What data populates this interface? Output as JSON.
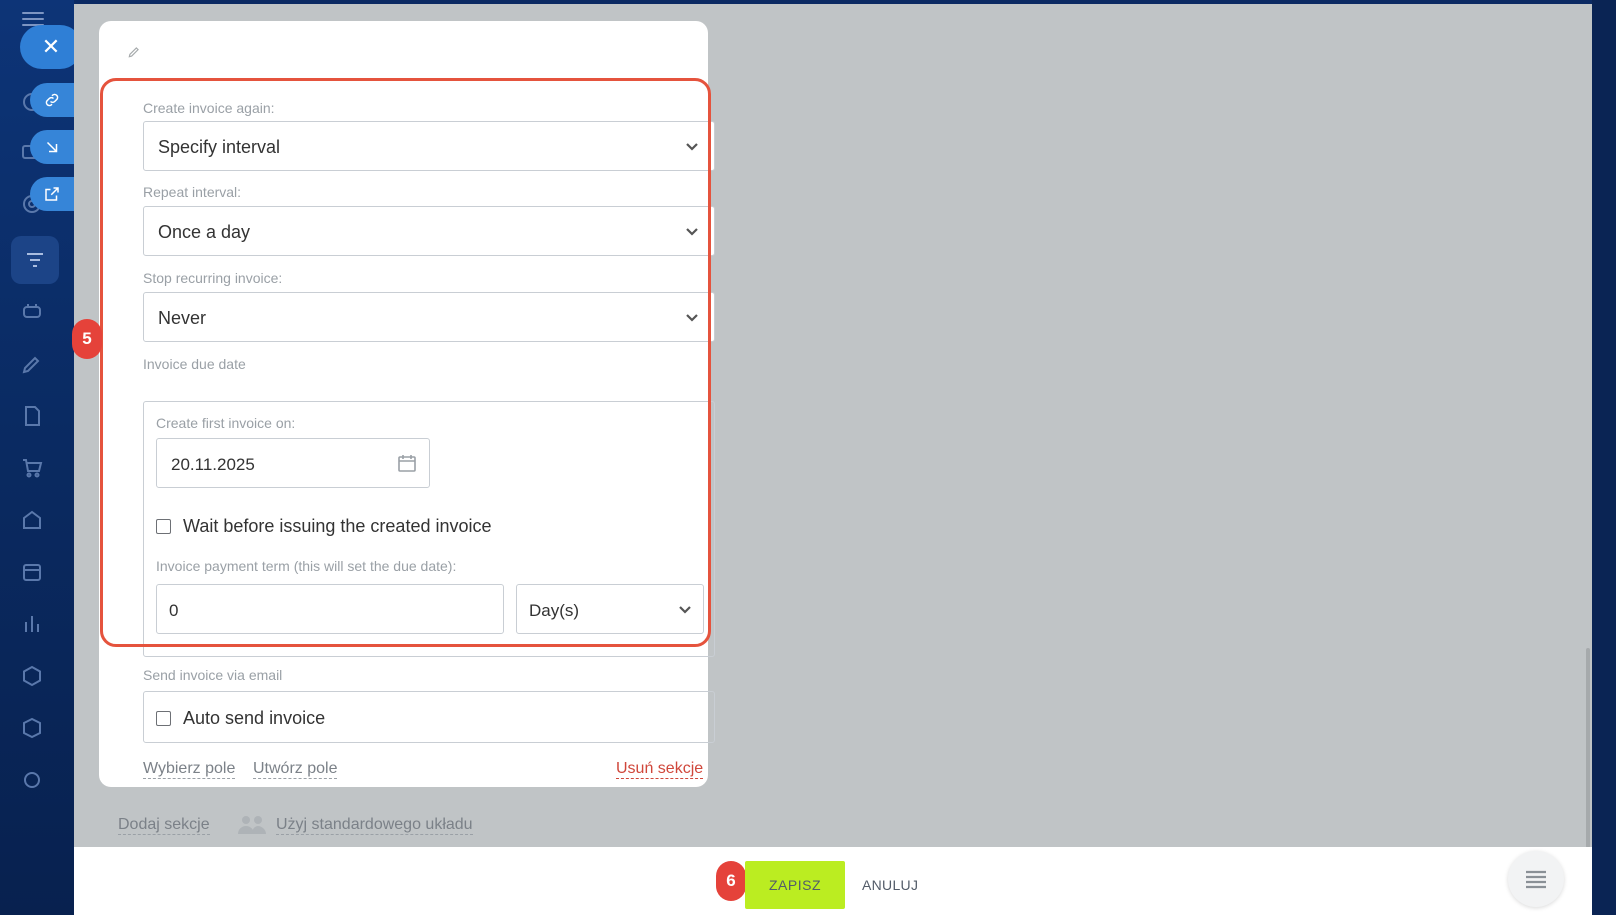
{
  "form": {
    "create_again_label": "Create invoice again:",
    "create_again_value": "Specify interval",
    "repeat_interval_label": "Repeat interval:",
    "repeat_interval_value": "Once a day",
    "stop_label": "Stop recurring invoice:",
    "stop_value": "Never",
    "due_date_label": "Invoice due date",
    "first_invoice_label": "Create first invoice on:",
    "first_invoice_date": "20.11.2025",
    "wait_label": "Wait before issuing the created invoice",
    "payment_term_label": "Invoice payment term (this will set the due date):",
    "payment_term_value": "0",
    "payment_term_unit": "Day(s)",
    "email_label": "Send invoice via email",
    "auto_send_label": "Auto send invoice",
    "choose_field": "Wybierz pole",
    "create_field": "Utwórz pole",
    "delete_section": "Usuń sekcje"
  },
  "below": {
    "add_section": "Dodaj sekcje",
    "use_standard_layout": "Użyj standardowego układu"
  },
  "badges": {
    "step5": "5",
    "step6": "6"
  },
  "footer": {
    "save_label": "ZAPISZ",
    "cancel_label": "ANULUJ"
  },
  "colors": {
    "highlight": "#e5533d",
    "save_button": "#bbed21",
    "badge": "#e5423a",
    "sidebar": "#0d3477"
  },
  "icons": {
    "close": "close-icon",
    "link": "link-icon",
    "download": "download-icon",
    "external": "external-link-icon",
    "calendar": "calendar-icon",
    "people": "people-icon",
    "menu": "list-icon"
  }
}
